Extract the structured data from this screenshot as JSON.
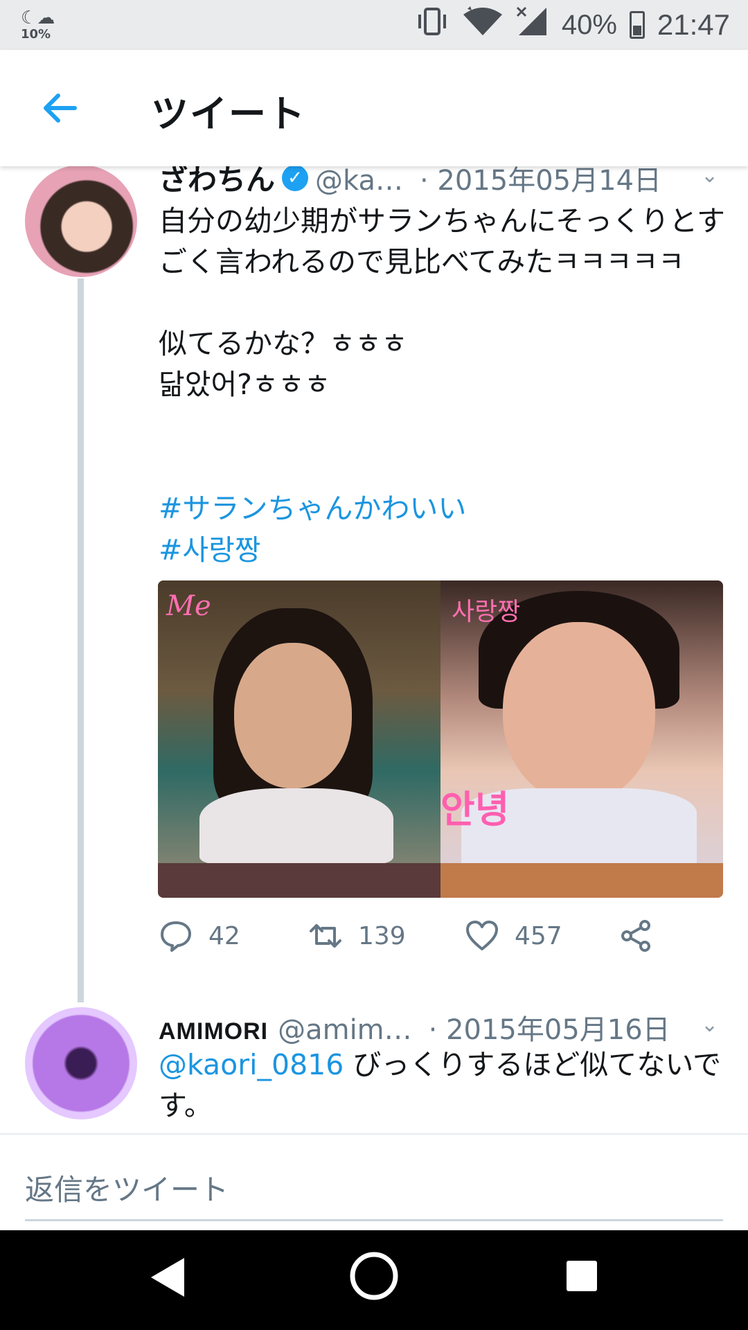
{
  "status_bar": {
    "weather_icon": "moon-cloud-icon",
    "weather_percent": "10%",
    "battery_percent": "40%",
    "time": "21:47"
  },
  "header": {
    "title": "ツイート"
  },
  "tweet1": {
    "name": "ざわちん",
    "handle": "@ka…",
    "date": "· 2015年05月14日",
    "text": "自分の幼少期がサランちゃんにそっくりとすごく言われるので見比べてみたㅋㅋㅋㅋㅋ\n\n似てるかな？ㅎㅎㅎ\n닮았어?ㅎㅎㅎ",
    "hashtags": [
      "#サランちゃんかわいい",
      "#사랑짱"
    ],
    "media_labels": {
      "left": "Me",
      "right": "사랑짱",
      "right_bottom": "안녕"
    },
    "replies": "42",
    "retweets": "139",
    "likes": "457"
  },
  "tweet2": {
    "name": "AMIMORI",
    "handle": "@amim…",
    "date": "· 2015年05月16日",
    "mention": "@kaori_0816",
    "text": " びっくりするほど似てないです。"
  },
  "reply_box": {
    "placeholder": "返信をツイート"
  },
  "colors": {
    "link": "#1b95e0",
    "verified": "#1da1f2",
    "muted": "#657786"
  }
}
